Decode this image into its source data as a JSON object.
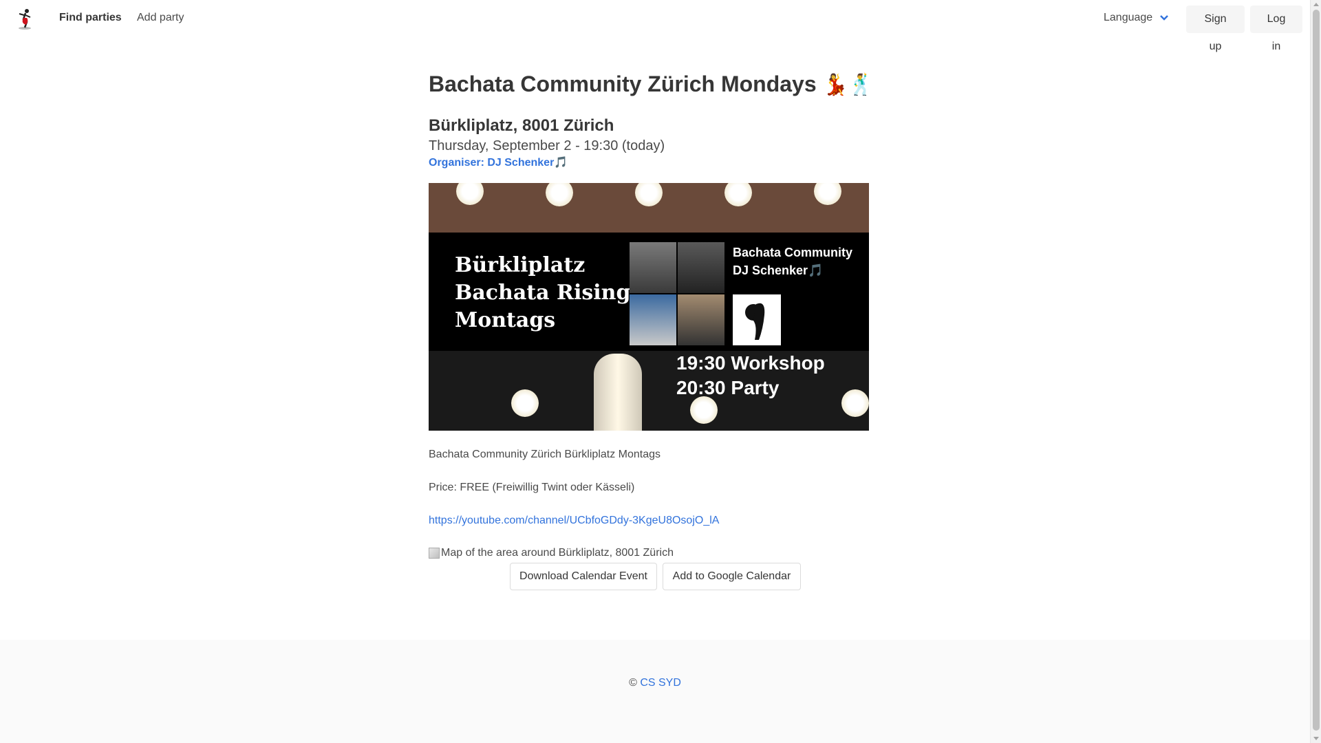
{
  "nav": {
    "logo_icon": "dancer-logo-icon",
    "find_parties": "Find parties",
    "add_party": "Add party",
    "language": "Language",
    "sign_up": "Sign up",
    "log_in": "Log in"
  },
  "event": {
    "title": "Bachata Community Zürich Mondays",
    "title_emoji": "💃🕺",
    "location": "Bürkliplatz, 8001 Zürich",
    "date": "Thursday, September 2 - 19:30 (today)",
    "organiser": "Organiser: DJ Schenker🎵",
    "poster": {
      "left_text": [
        "Bürkliplatz",
        "Bachata Rising",
        "Montags"
      ],
      "right_text": [
        "Bachata Community",
        "DJ Schenker🎵"
      ],
      "bottom_text": [
        "19:30 Workshop",
        "20:30 Party"
      ]
    },
    "description": "Bachata Community Zürich Bürkliplatz Montags",
    "price": "Price: FREE (Freiwillig Twint oder Kässeli)",
    "link": "https://youtube.com/channel/UCbfoGDdy-3KgeU8OsojO_lA",
    "map_alt": "Map of the area around Bürkliplatz, 8001 Zürich",
    "download_calendar": "Download Calendar Event",
    "add_google_calendar": "Add to Google Calendar"
  },
  "footer": {
    "copyright": "©",
    "link": "CS SYD"
  },
  "colors": {
    "link": "#3273dc",
    "text": "#363636",
    "button_bg": "#f5f5f5",
    "footer_bg": "#fafafa"
  }
}
